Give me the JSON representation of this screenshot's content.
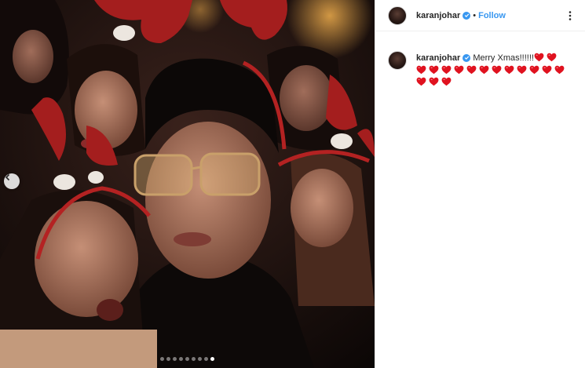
{
  "post": {
    "username": "karanjohar",
    "separator": "•",
    "follow_label": "Follow",
    "verified": true
  },
  "caption": {
    "username": "karanjohar",
    "text": "Merry Xmas!!!!!!",
    "heart_count": 17,
    "heart_emoji": "heart"
  },
  "carousel": {
    "total_slides": 9,
    "current_slide": 9
  },
  "colors": {
    "link_blue": "#3897f0",
    "heart_red": "#e0121f",
    "text": "#262626"
  }
}
